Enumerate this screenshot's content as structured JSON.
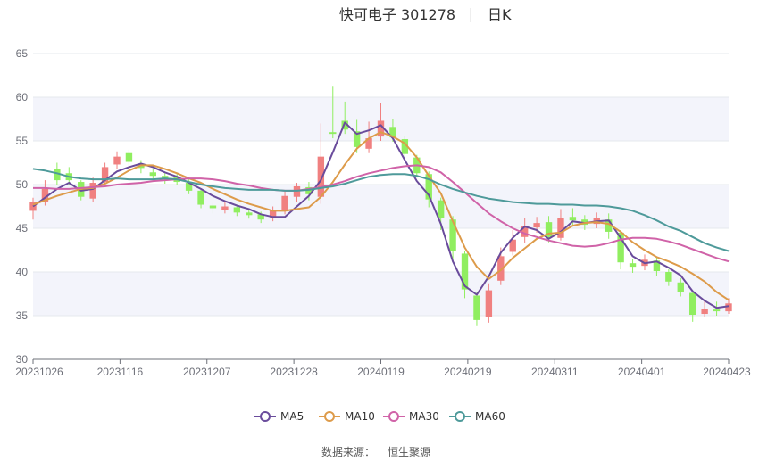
{
  "chart_data": {
    "type": "candlestick",
    "title": "快可电子 301278",
    "period_label": "日K",
    "source_label": "数据来源：",
    "source_name": "恒生聚源",
    "ylim": [
      30,
      65
    ],
    "yticks": [
      30,
      35,
      40,
      45,
      50,
      55,
      60,
      65
    ],
    "xtick_labels": [
      "20231026",
      "20231116",
      "20231207",
      "20231228",
      "20240119",
      "20240219",
      "20240311",
      "20240401",
      "20240423"
    ],
    "grid": true,
    "legend_position": "bottom-center",
    "colors": {
      "up": "#f08080",
      "down": "#90ee60",
      "ma5": "#6a4c9c",
      "ma10": "#dd9b4a",
      "ma30": "#d063a8",
      "ma60": "#4e9a9a",
      "band": "#f3f4fb",
      "grid": "#e6e8ee",
      "axis": "#6e7079"
    },
    "series": [
      {
        "name": "MA5",
        "key": "ma5",
        "values": [
          47.5,
          48.5,
          49.5,
          50.2,
          49.3,
          49.5,
          50.5,
          51.5,
          52.0,
          52.4,
          52.0,
          51.4,
          50.9,
          50.2,
          49.5,
          48.7,
          48.1,
          47.6,
          47.2,
          46.6,
          46.3,
          46.3,
          47.5,
          48.7,
          50.5,
          53.7,
          57.1,
          55.8,
          56.2,
          56.8,
          55.3,
          52.8,
          50.4,
          48.8,
          45.5,
          41.2,
          38.4,
          37.4,
          39.5,
          42.2,
          43.9,
          45.2,
          44.8,
          43.8,
          44.6,
          45.8,
          45.6,
          45.8,
          45.9,
          43.9,
          41.8,
          41.0,
          41.2,
          40.5,
          39.6,
          37.8,
          36.7,
          35.9,
          36.1
        ]
      },
      {
        "name": "MA10",
        "key": "ma10",
        "values": [
          47.7,
          48.2,
          48.7,
          49.1,
          49.5,
          49.6,
          50.1,
          50.8,
          51.6,
          52.2,
          52.2,
          51.8,
          51.3,
          50.7,
          50.2,
          49.5,
          48.9,
          48.3,
          47.8,
          47.4,
          47.0,
          47.0,
          47.2,
          47.4,
          48.6,
          50.3,
          52.3,
          54.1,
          55.3,
          56.0,
          55.5,
          54.7,
          53.1,
          51.0,
          49.0,
          45.8,
          42.8,
          40.6,
          39.2,
          40.2,
          41.6,
          42.7,
          43.8,
          44.4,
          44.5,
          45.3,
          45.6,
          45.7,
          45.5,
          44.6,
          43.4,
          42.5,
          41.7,
          41.2,
          40.6,
          39.8,
          38.9,
          37.7,
          36.8
        ]
      },
      {
        "name": "MA30",
        "key": "ma30",
        "values": [
          49.6,
          49.6,
          49.5,
          49.5,
          49.6,
          49.7,
          49.8,
          50.0,
          50.1,
          50.2,
          50.4,
          50.5,
          50.6,
          50.7,
          50.7,
          50.6,
          50.4,
          50.1,
          49.9,
          49.6,
          49.4,
          49.3,
          49.3,
          49.5,
          49.7,
          50.0,
          50.4,
          50.9,
          51.3,
          51.6,
          51.9,
          52.1,
          52.2,
          52.0,
          51.4,
          50.3,
          49.1,
          47.9,
          46.7,
          45.8,
          45.0,
          44.4,
          44.0,
          43.6,
          43.3,
          43.0,
          42.9,
          43.0,
          43.3,
          43.7,
          43.9,
          43.9,
          43.8,
          43.5,
          43.1,
          42.6,
          42.1,
          41.6,
          41.2
        ]
      },
      {
        "name": "MA60",
        "key": "ma60",
        "values": [
          51.8,
          51.6,
          51.3,
          50.9,
          50.7,
          50.6,
          50.6,
          50.7,
          50.6,
          50.6,
          50.6,
          50.7,
          50.6,
          50.3,
          50.0,
          49.8,
          49.6,
          49.5,
          49.4,
          49.4,
          49.4,
          49.3,
          49.3,
          49.4,
          49.6,
          49.8,
          50.1,
          50.5,
          50.9,
          51.1,
          51.2,
          51.2,
          51.0,
          50.6,
          50.0,
          49.5,
          49.1,
          48.7,
          48.4,
          48.2,
          48.0,
          47.9,
          47.8,
          47.8,
          47.7,
          47.7,
          47.6,
          47.6,
          47.5,
          47.3,
          47.0,
          46.5,
          45.9,
          45.2,
          44.7,
          44.0,
          43.3,
          42.8,
          42.4
        ]
      }
    ],
    "candles": [
      [
        47.0,
        48.0,
        48.5,
        46.0
      ],
      [
        48.0,
        49.5,
        50.5,
        47.6
      ],
      [
        51.8,
        50.5,
        52.5,
        50.0
      ],
      [
        51.3,
        50.5,
        52.0,
        50.0
      ],
      [
        50.3,
        48.6,
        50.5,
        48.2
      ],
      [
        48.4,
        50.2,
        50.8,
        48.0
      ],
      [
        50.3,
        52.0,
        52.5,
        50.0
      ],
      [
        52.3,
        53.2,
        53.8,
        51.8
      ],
      [
        53.6,
        52.6,
        54.0,
        52.0
      ],
      [
        52.4,
        51.9,
        52.8,
        51.3
      ],
      [
        51.4,
        51.0,
        51.8,
        50.6
      ],
      [
        51.0,
        50.6,
        51.3,
        50.1
      ],
      [
        50.9,
        50.3,
        51.2,
        49.9
      ],
      [
        50.2,
        49.3,
        50.6,
        48.9
      ],
      [
        49.3,
        47.7,
        49.5,
        47.3
      ],
      [
        47.6,
        47.3,
        47.9,
        46.7
      ],
      [
        47.1,
        47.5,
        48.0,
        46.7
      ],
      [
        47.4,
        46.8,
        47.7,
        46.4
      ],
      [
        46.8,
        46.5,
        47.1,
        46.1
      ],
      [
        46.6,
        46.0,
        46.9,
        45.6
      ],
      [
        46.2,
        47.1,
        47.5,
        45.8
      ],
      [
        47.0,
        48.7,
        49.2,
        46.6
      ],
      [
        48.6,
        49.8,
        50.2,
        48.0
      ],
      [
        49.7,
        48.9,
        50.3,
        48.2
      ],
      [
        48.6,
        53.2,
        57.0,
        47.8
      ],
      [
        56.0,
        55.8,
        61.2,
        55.3
      ],
      [
        57.3,
        56.3,
        59.5,
        55.8
      ],
      [
        56.1,
        54.3,
        57.4,
        53.6
      ],
      [
        54.1,
        55.3,
        57.2,
        53.6
      ],
      [
        55.5,
        57.3,
        59.3,
        55.0
      ],
      [
        56.6,
        55.4,
        57.5,
        54.9
      ],
      [
        55.2,
        53.5,
        55.6,
        53.0
      ],
      [
        53.1,
        51.3,
        53.4,
        50.8
      ],
      [
        51.2,
        48.3,
        51.5,
        47.4
      ],
      [
        48.2,
        46.2,
        48.5,
        44.8
      ],
      [
        46.0,
        42.4,
        46.4,
        41.3
      ],
      [
        42.1,
        38.0,
        42.4,
        37.0
      ],
      [
        37.3,
        34.5,
        37.7,
        33.8
      ],
      [
        34.9,
        37.9,
        38.7,
        34.2
      ],
      [
        39.0,
        41.8,
        42.8,
        38.5
      ],
      [
        42.3,
        43.7,
        44.8,
        41.9
      ],
      [
        44.0,
        45.2,
        46.2,
        43.3
      ],
      [
        45.1,
        45.6,
        46.3,
        44.5
      ],
      [
        45.7,
        44.0,
        46.4,
        43.4
      ],
      [
        43.9,
        46.2,
        47.2,
        43.6
      ],
      [
        46.3,
        45.9,
        47.3,
        45.4
      ],
      [
        46.0,
        45.4,
        46.5,
        44.8
      ],
      [
        45.5,
        46.2,
        46.8,
        45.0
      ],
      [
        46.0,
        44.6,
        46.7,
        43.8
      ],
      [
        44.5,
        41.1,
        44.8,
        40.3
      ],
      [
        41.0,
        40.6,
        41.5,
        39.9
      ],
      [
        40.7,
        41.4,
        42.0,
        40.2
      ],
      [
        41.3,
        40.1,
        41.7,
        39.5
      ],
      [
        40.0,
        38.9,
        40.3,
        38.4
      ],
      [
        38.8,
        37.7,
        39.3,
        37.2
      ],
      [
        37.6,
        35.1,
        37.9,
        34.3
      ],
      [
        35.2,
        35.8,
        36.8,
        34.8
      ],
      [
        35.7,
        35.5,
        36.6,
        35.0
      ],
      [
        35.5,
        36.4,
        37.0,
        35.2
      ]
    ]
  }
}
